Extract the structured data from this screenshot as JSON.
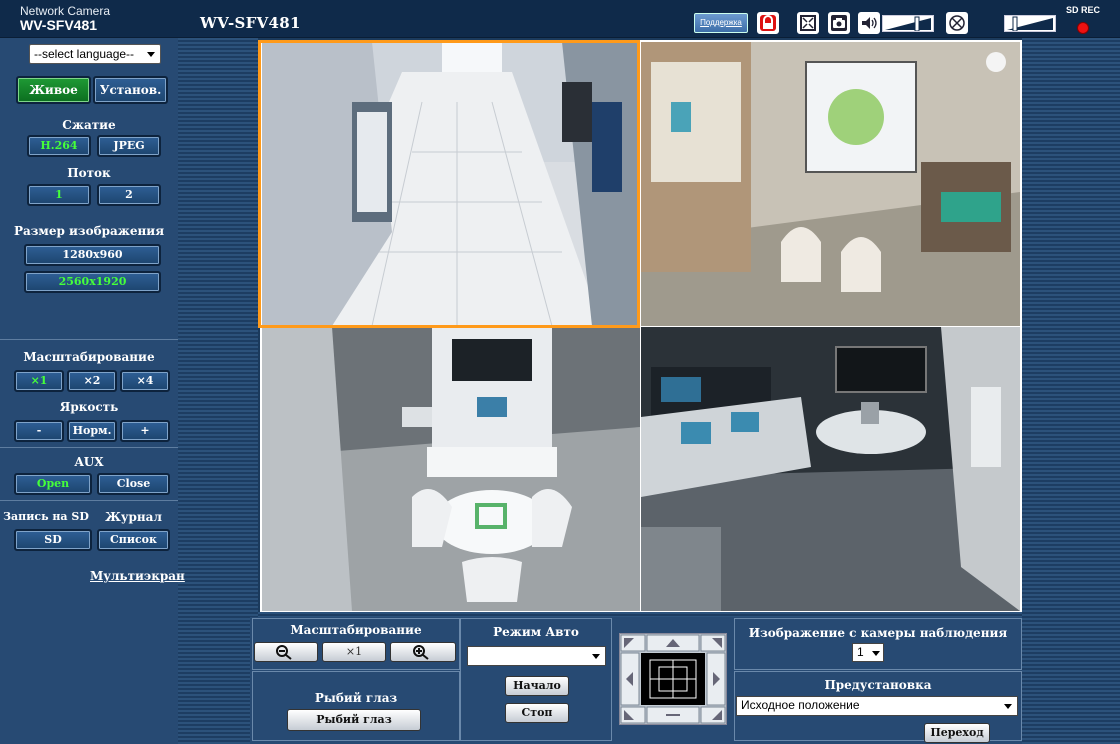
{
  "header": {
    "brand_top": "Network Camera",
    "brand_model": "WV-SFV481",
    "model_title": "WV-SFV481",
    "support_label": "Поддержка",
    "sd_rec_label": "SD REC",
    "icons": [
      "lock-icon",
      "fullscreen-icon",
      "snapshot-icon",
      "speaker-icon",
      "volume-bar-icon",
      "mute-icon",
      "mic-volume-bar-icon"
    ]
  },
  "sidebar": {
    "language_select": "--select language--",
    "live_button": "Живое",
    "setup_button": "Установ.",
    "compression_label": "Сжатие",
    "compression_options": [
      "H.264",
      "JPEG"
    ],
    "stream_label": "Поток",
    "stream_options": [
      "1",
      "2"
    ],
    "image_size_label": "Размер изображения",
    "image_sizes": [
      "1280x960",
      "2560x1920"
    ],
    "zoom_label": "Масштабирование",
    "zoom_options": [
      "×1",
      "×2",
      "×4"
    ],
    "brightness_label": "Яркость",
    "brightness_options": [
      "-",
      "Норм.",
      "+"
    ],
    "aux_label": "AUX",
    "aux_options": [
      "Open",
      "Close"
    ],
    "sd_record_label": "Запись на SD",
    "log_label": "Журнал",
    "sd_button": "SD",
    "list_button": "Список",
    "multiscreen_link": "Мультиэкран"
  },
  "controls": {
    "zoom_label": "Масштабирование",
    "zoom_reset": "×1",
    "fisheye_label": "Рыбий глаз",
    "fisheye_button": "Рыбий глаз",
    "auto_mode_label": "Режим Авто",
    "auto_mode_value": "",
    "start_button": "Начало",
    "stop_button": "Стоп",
    "camera_image_label": "Изображение с камеры наблюдения",
    "camera_image_value": "1",
    "preset_label": "Предустановка",
    "preset_value": "Исходное положение",
    "go_button": "Переход"
  },
  "colors": {
    "active_green": "#45ff3a",
    "selected_tile_border": "#ff9a1a",
    "panel_blue": "#274a73",
    "rec_red": "#e11111"
  }
}
